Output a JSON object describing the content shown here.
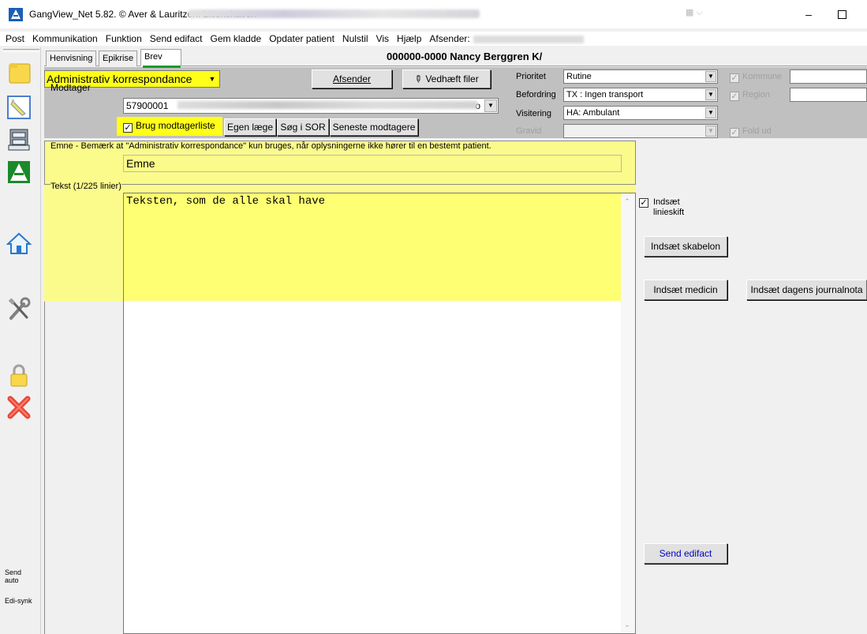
{
  "window": {
    "title": "GangView_Net 5.82. © Aver & Lauritzen. Licenshaver:"
  },
  "menu": [
    "Post",
    "Kommunikation",
    "Funktion",
    "Send edifact",
    "Gem kladde",
    "Opdater patient",
    "Nulstil",
    "Vis",
    "Hjælp",
    "Afsender:"
  ],
  "tabs": [
    "Henvisning",
    "Epikrise",
    "Brev"
  ],
  "patient": {
    "title": "000000-0000 Nancy Berggren K/"
  },
  "toolbar": {
    "send_auto_1": "Send",
    "send_auto_2": "auto",
    "edi_sync": "Edi-synk"
  },
  "letter": {
    "type": "Administrativ korrespondance",
    "afsender_button": "Afsender",
    "attach_button": "Vedhæft filer",
    "receiver_label": "Modtager",
    "receiver_value": "57900001",
    "receiver_suffix": "o",
    "use_receiver_list": "Brug modtagerliste",
    "own_doctor_button": "Egen læge",
    "sor_button": "Søg i SOR",
    "recent_receivers_button": "Seneste modtagere"
  },
  "priority": {
    "label": "Prioritet",
    "value": "Rutine"
  },
  "transport": {
    "label": "Befordring",
    "value": "TX : Ingen transport"
  },
  "visit": {
    "label": "Visitering",
    "value": "HA: Ambulant"
  },
  "pregnant": {
    "label": "Gravid",
    "value": ""
  },
  "right_checks": {
    "municipality": "Kommune",
    "region": "Region",
    "fold_out": "Fold ud"
  },
  "subject": {
    "legend": "Emne - Bemærk at \"Administrativ korrespondance\" kun bruges, når oplysningerne ikke hører til en bestemt patient.",
    "value": "Emne"
  },
  "text": {
    "legend": "Tekst (1/225 linier)",
    "value": "Teksten, som de alle skal have"
  },
  "side_actions": {
    "insert_linebreak_1": "Indsæt",
    "insert_linebreak_2": "linieskift",
    "insert_template": "Indsæt skabelon",
    "insert_medicine": "Indsæt medicin",
    "insert_journal": "Indsæt dagens journalnota",
    "send_edifact": "Send edifact"
  },
  "colors": {
    "highlight": "#ffff00",
    "highlight_soft": "#fbfb8c",
    "panel": "#c0c0c0"
  }
}
